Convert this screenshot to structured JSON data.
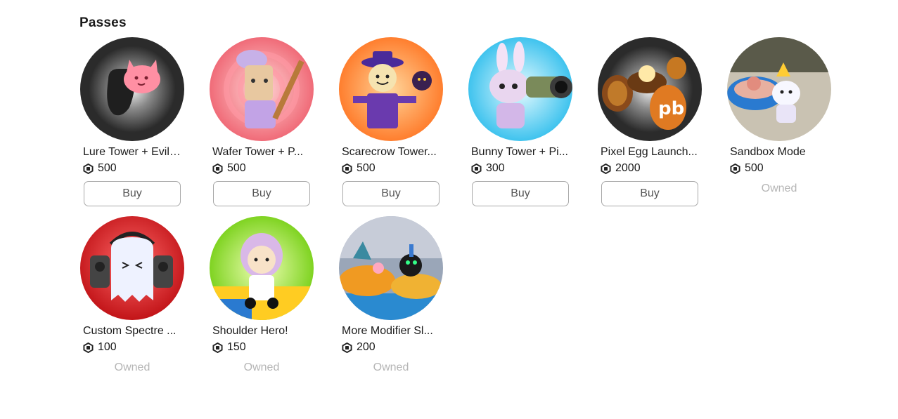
{
  "section": {
    "title": "Passes"
  },
  "passes": [
    {
      "name": "Lure Tower + Evil ...",
      "price": "500",
      "status": "Buy",
      "icon": "lure-tower-icon"
    },
    {
      "name": "Wafer Tower + P...",
      "price": "500",
      "status": "Buy",
      "icon": "wafer-tower-icon"
    },
    {
      "name": "Scarecrow Tower...",
      "price": "500",
      "status": "Buy",
      "icon": "scarecrow-tower-icon"
    },
    {
      "name": "Bunny Tower + Pi...",
      "price": "300",
      "status": "Buy",
      "icon": "bunny-tower-icon"
    },
    {
      "name": "Pixel Egg Launch...",
      "price": "2000",
      "status": "Buy",
      "icon": "pixel-egg-icon"
    },
    {
      "name": "Sandbox Mode",
      "price": "500",
      "status": "Owned",
      "icon": "sandbox-mode-icon"
    },
    {
      "name": "Custom Spectre ...",
      "price": "100",
      "status": "Owned",
      "icon": "custom-spectre-icon"
    },
    {
      "name": "Shoulder Hero!",
      "price": "150",
      "status": "Owned",
      "icon": "shoulder-hero-icon"
    },
    {
      "name": "More Modifier Sl...",
      "price": "200",
      "status": "Owned",
      "icon": "more-modifier-icon"
    }
  ]
}
